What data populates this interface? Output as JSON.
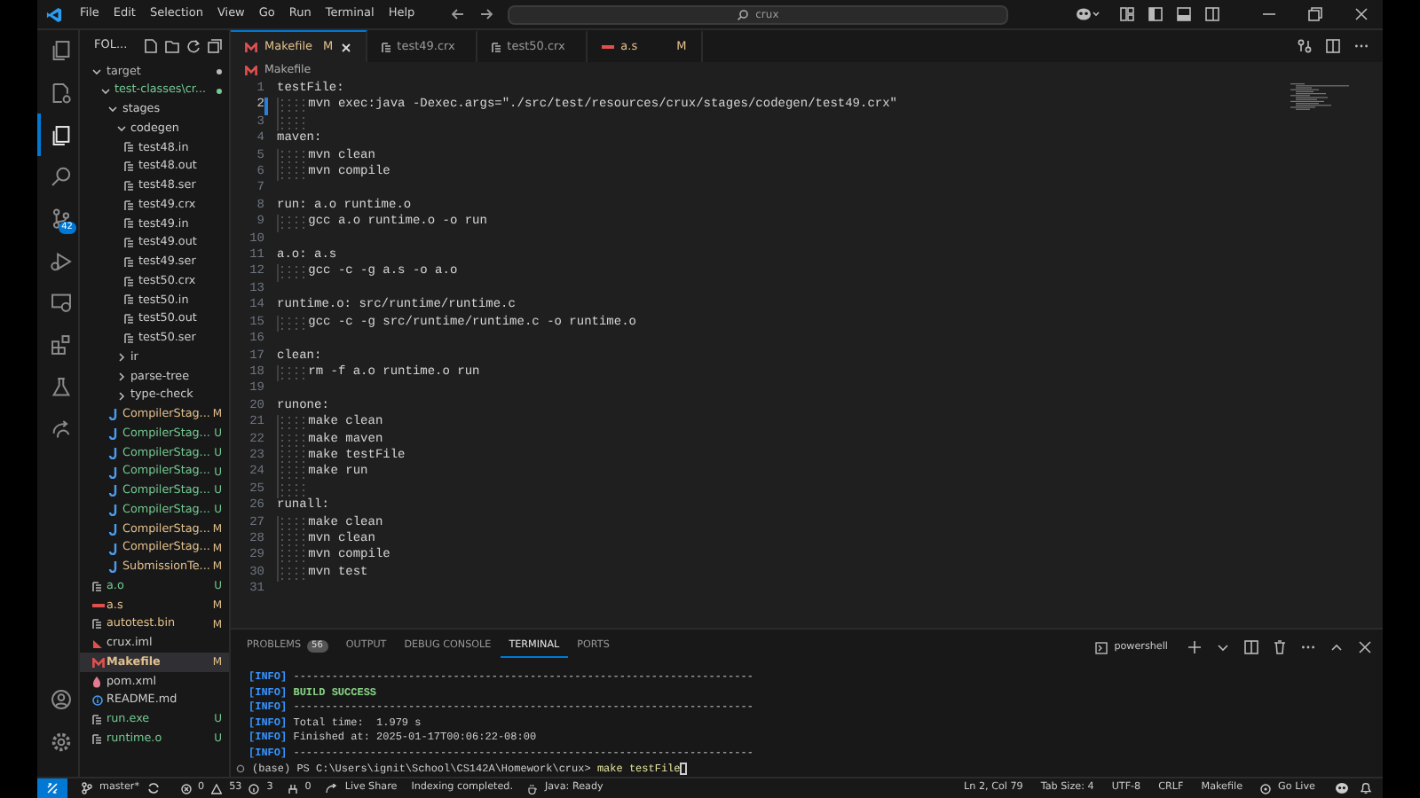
{
  "title_bar": {
    "menus": [
      "File",
      "Edit",
      "Selection",
      "View",
      "Go",
      "Run",
      "Terminal",
      "Help"
    ],
    "search": {
      "value": "crux"
    }
  },
  "activity_bar": {
    "items": [
      {
        "kind": "files",
        "selected": false
      },
      {
        "kind": "doc-gear",
        "selected": false
      },
      {
        "kind": "explorer",
        "selected": true
      },
      {
        "kind": "search",
        "selected": false
      },
      {
        "kind": "source-control",
        "selected": false,
        "badge": "42"
      },
      {
        "kind": "run",
        "selected": false
      },
      {
        "kind": "remote",
        "selected": false
      },
      {
        "kind": "extensions",
        "selected": false
      },
      {
        "kind": "testing",
        "selected": false
      },
      {
        "kind": "live-share",
        "selected": false
      }
    ],
    "bottom": [
      {
        "kind": "account"
      },
      {
        "kind": "settings"
      }
    ]
  },
  "explorer": {
    "header": "FOL...",
    "tree": [
      {
        "label": "target",
        "kind": "folder",
        "expanded": true,
        "dot": true,
        "color": "#b8b8b8",
        "selected": false,
        "children": [
          {
            "label": "test-classes\\cr...",
            "kind": "folder",
            "expanded": true,
            "dot": true,
            "color": "#73c991",
            "selected": false,
            "children": [
              {
                "label": "stages",
                "kind": "folder",
                "expanded": true,
                "selected": false,
                "children": [
                  {
                    "label": "codegen",
                    "kind": "folder",
                    "expanded": true,
                    "selected": false,
                    "children": [
                      {
                        "label": "test48.in",
                        "kind": "file",
                        "selected": false
                      },
                      {
                        "label": "test48.out",
                        "kind": "file",
                        "selected": false
                      },
                      {
                        "label": "test48.ser",
                        "kind": "file",
                        "selected": false
                      },
                      {
                        "label": "test49.crx",
                        "kind": "file",
                        "selected": false
                      },
                      {
                        "label": "test49.in",
                        "kind": "file",
                        "selected": false
                      },
                      {
                        "label": "test49.out",
                        "kind": "file",
                        "selected": false
                      },
                      {
                        "label": "test49.ser",
                        "kind": "file",
                        "selected": false
                      },
                      {
                        "label": "test50.crx",
                        "kind": "file",
                        "selected": false
                      },
                      {
                        "label": "test50.in",
                        "kind": "file",
                        "selected": false
                      },
                      {
                        "label": "test50.out",
                        "kind": "file",
                        "selected": false
                      },
                      {
                        "label": "test50.ser",
                        "kind": "file",
                        "selected": false
                      }
                    ]
                  },
                  {
                    "label": "ir",
                    "kind": "folder",
                    "expanded": false,
                    "selected": false
                  },
                  {
                    "label": "parse-tree",
                    "kind": "folder",
                    "expanded": false,
                    "selected": false
                  },
                  {
                    "label": "type-check",
                    "kind": "folder",
                    "expanded": false,
                    "selected": false
                  }
                ]
              },
              {
                "label": "CompilerStag...",
                "kind": "java",
                "badge": "M",
                "color": "#e2c08d",
                "selected": false
              },
              {
                "label": "CompilerStag...",
                "kind": "java",
                "badge": "U",
                "color": "#73c991",
                "selected": false
              },
              {
                "label": "CompilerStag...",
                "kind": "java",
                "badge": "U",
                "color": "#73c991",
                "selected": false
              },
              {
                "label": "CompilerStag...",
                "kind": "java",
                "badge": "U",
                "color": "#73c991",
                "selected": false
              },
              {
                "label": "CompilerStag...",
                "kind": "java",
                "badge": "U",
                "color": "#73c991",
                "selected": false
              },
              {
                "label": "CompilerStag...",
                "kind": "java",
                "badge": "U",
                "color": "#73c991",
                "selected": false
              },
              {
                "label": "CompilerStag...",
                "kind": "java",
                "badge": "M",
                "color": "#e2c08d",
                "selected": false
              },
              {
                "label": "CompilerStag...",
                "kind": "java",
                "badge": "M",
                "color": "#e2c08d",
                "selected": false
              },
              {
                "label": "SubmissionTe...",
                "kind": "java",
                "badge": "M",
                "color": "#e2c08d",
                "selected": false
              }
            ]
          }
        ]
      },
      {
        "label": "a.o",
        "kind": "file",
        "badge": "U",
        "color": "#73c991",
        "selected": false
      },
      {
        "label": "a.s",
        "kind": "asm",
        "badge": "M",
        "color": "#e2c08d",
        "selected": false
      },
      {
        "label": "autotest.bin",
        "kind": "file",
        "badge": "M",
        "color": "#e2c08d",
        "selected": false
      },
      {
        "label": "crux.iml",
        "kind": "iml",
        "selected": false
      },
      {
        "label": "Makefile",
        "kind": "makefile",
        "badge": "M",
        "color": "#e2c08d",
        "selected": true
      },
      {
        "label": "pom.xml",
        "kind": "xml",
        "selected": false
      },
      {
        "label": "README.md",
        "kind": "info",
        "selected": false
      },
      {
        "label": "run.exe",
        "kind": "file",
        "badge": "U",
        "color": "#73c991",
        "selected": false
      },
      {
        "label": "runtime.o",
        "kind": "file",
        "badge": "U",
        "color": "#73c991",
        "selected": false
      }
    ]
  },
  "tabs": [
    {
      "label": "Makefile",
      "kind": "makefile",
      "badge": "M",
      "selected": true
    },
    {
      "label": "test49.crx",
      "kind": "file",
      "selected": false
    },
    {
      "label": "test50.crx",
      "kind": "file",
      "selected": false
    },
    {
      "label": "a.s",
      "kind": "asm",
      "badge": "M",
      "selected": false
    }
  ],
  "breadcrumb": {
    "label": "Makefile",
    "kind": "makefile"
  },
  "code": [
    {
      "number": "1",
      "text": "testFile:",
      "indent": false,
      "current": false
    },
    {
      "number": "2",
      "text": "mvn exec:java -Dexec.args=\"./src/test/resources/crux/stages/codegen/test49.crx\"",
      "indent": true,
      "current": true
    },
    {
      "number": "3",
      "indent": true,
      "current": false
    },
    {
      "number": "4",
      "text": "maven:",
      "indent": false,
      "current": false
    },
    {
      "number": "5",
      "text": "mvn clean",
      "indent": true,
      "current": false
    },
    {
      "number": "6",
      "text": "mvn compile",
      "indent": true,
      "current": false
    },
    {
      "number": "7",
      "indent": false,
      "current": false
    },
    {
      "number": "8",
      "text": "run: a.o runtime.o",
      "indent": false,
      "current": false
    },
    {
      "number": "9",
      "text": "gcc a.o runtime.o -o run",
      "indent": true,
      "current": false
    },
    {
      "number": "10",
      "indent": false,
      "current": false
    },
    {
      "number": "11",
      "text": "a.o: a.s",
      "indent": false,
      "current": false
    },
    {
      "number": "12",
      "text": "gcc -c -g a.s -o a.o",
      "indent": true,
      "current": false
    },
    {
      "number": "13",
      "indent": false,
      "current": false
    },
    {
      "number": "14",
      "text": "runtime.o: src/runtime/runtime.c",
      "indent": false,
      "current": false
    },
    {
      "number": "15",
      "text": "gcc -c -g src/runtime/runtime.c -o runtime.o",
      "indent": true,
      "current": false
    },
    {
      "number": "16",
      "indent": false,
      "current": false
    },
    {
      "number": "17",
      "text": "clean:",
      "indent": false,
      "current": false
    },
    {
      "number": "18",
      "text": "rm -f a.o runtime.o run",
      "indent": true,
      "current": false
    },
    {
      "number": "19",
      "indent": false,
      "current": false
    },
    {
      "number": "20",
      "text": "runone:",
      "indent": false,
      "current": false
    },
    {
      "number": "21",
      "text": "make clean",
      "indent": true,
      "current": false
    },
    {
      "number": "22",
      "text": "make maven",
      "indent": true,
      "current": false
    },
    {
      "number": "23",
      "text": "make testFile",
      "indent": true,
      "current": false
    },
    {
      "number": "24",
      "text": "make run",
      "indent": true,
      "current": false
    },
    {
      "number": "25",
      "indent": true,
      "current": false
    },
    {
      "number": "26",
      "text": "runall:",
      "indent": false,
      "current": false
    },
    {
      "number": "27",
      "text": "make clean",
      "indent": true,
      "current": false
    },
    {
      "number": "28",
      "text": "mvn clean",
      "indent": true,
      "current": false
    },
    {
      "number": "29",
      "text": "mvn compile",
      "indent": true,
      "current": false
    },
    {
      "number": "30",
      "text": "mvn test",
      "indent": true,
      "current": false
    },
    {
      "number": "31",
      "indent": false,
      "current": false
    }
  ],
  "panel": {
    "tabs": [
      {
        "label": "PROBLEMS",
        "count": "56",
        "selected": false
      },
      {
        "label": "OUTPUT",
        "selected": false
      },
      {
        "label": "DEBUG CONSOLE",
        "selected": false
      },
      {
        "label": "TERMINAL",
        "selected": true
      },
      {
        "label": "PORTS",
        "selected": false
      }
    ],
    "shell": "powershell",
    "terminal": [
      {
        "tag": "[INFO]",
        "text": "------------------------------------------------------------------------",
        "success": false
      },
      {
        "tag": "[INFO]",
        "text": "BUILD SUCCESS",
        "success": true
      },
      {
        "tag": "[INFO]",
        "text": "------------------------------------------------------------------------",
        "success": false
      },
      {
        "tag": "[INFO]",
        "text": "Total time:  1.979 s",
        "success": false
      },
      {
        "tag": "[INFO]",
        "text": "Finished at: 2025-01-17T00:06:22-08:00",
        "success": false
      },
      {
        "tag": "[INFO]",
        "text": "------------------------------------------------------------------------",
        "success": false
      }
    ],
    "prompt": "(base) PS C:\\Users\\ignit\\School\\CS142A\\Homework\\crux>",
    "command": "make testFile"
  },
  "status_bar": {
    "branch": "master*",
    "errors": "0",
    "warnings": "53",
    "infos": "3",
    "ports": "0",
    "left": [
      "Live Share",
      "Indexing completed.",
      "Java: Ready"
    ],
    "right": [
      "Ln 2, Col 79",
      "Tab Size: 4",
      "UTF-8",
      "CRLF",
      "Makefile",
      "Go Live"
    ]
  }
}
